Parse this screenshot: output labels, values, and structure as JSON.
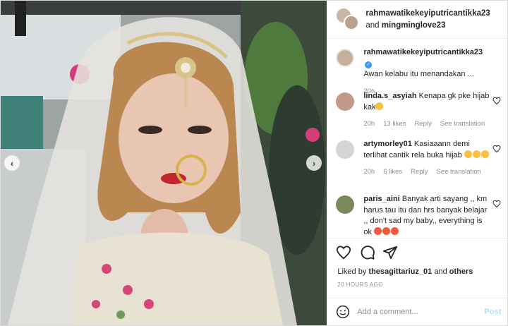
{
  "post": {
    "image_alt": "Woman in bridal veil with maang tikka and nose ring",
    "carousel": {
      "prev_icon": "chevron-left-icon",
      "next_icon": "chevron-right-icon",
      "prev": "‹",
      "next": "›"
    }
  },
  "header": {
    "user1": "rahmawatikekeyiputricantikka23",
    "and_text": "and",
    "user2": "mingminglove23"
  },
  "caption": {
    "username": "rahmawatikekeyiputricantikka23",
    "verified_mark": "✓",
    "text": "Awan kelabu itu menandakan ...",
    "time": "20h"
  },
  "comments": [
    {
      "username": "linda.s_asyiah",
      "text": "Kenapa gk pke hijab kak",
      "emojis": 1,
      "time": "20h",
      "likes": "13 likes",
      "reply": "Reply",
      "translate": "See translation"
    },
    {
      "username": "artymorley01",
      "text": "Kasiaaann demi terlihat cantik rela buka hijab",
      "emojis": 3,
      "time": "20h",
      "likes": "6 likes",
      "reply": "Reply",
      "translate": "See translation"
    },
    {
      "username": "paris_aini",
      "text": "Banyak arti sayang ,, km harus tau itu dan hrs banyak belajar ,, don't sad my baby,, everything is ok",
      "emojis": 3,
      "time": "",
      "likes": "",
      "reply": "",
      "translate": ""
    }
  ],
  "actions": {
    "like_icon": "heart-icon",
    "comment_icon": "comment-icon",
    "share_icon": "share-icon"
  },
  "liked_by": {
    "prefix": "Liked by",
    "user": "thesagittariuz_01",
    "and": "and",
    "others": "others"
  },
  "timestamp": "20 HOURS AGO",
  "add_comment": {
    "placeholder": "Add a comment...",
    "post_label": "Post",
    "emoji_icon": "smiley-icon"
  },
  "colors": {
    "accent": "#0095f6",
    "post_disabled": "#b2dffc",
    "muted": "#8e8e8e"
  }
}
